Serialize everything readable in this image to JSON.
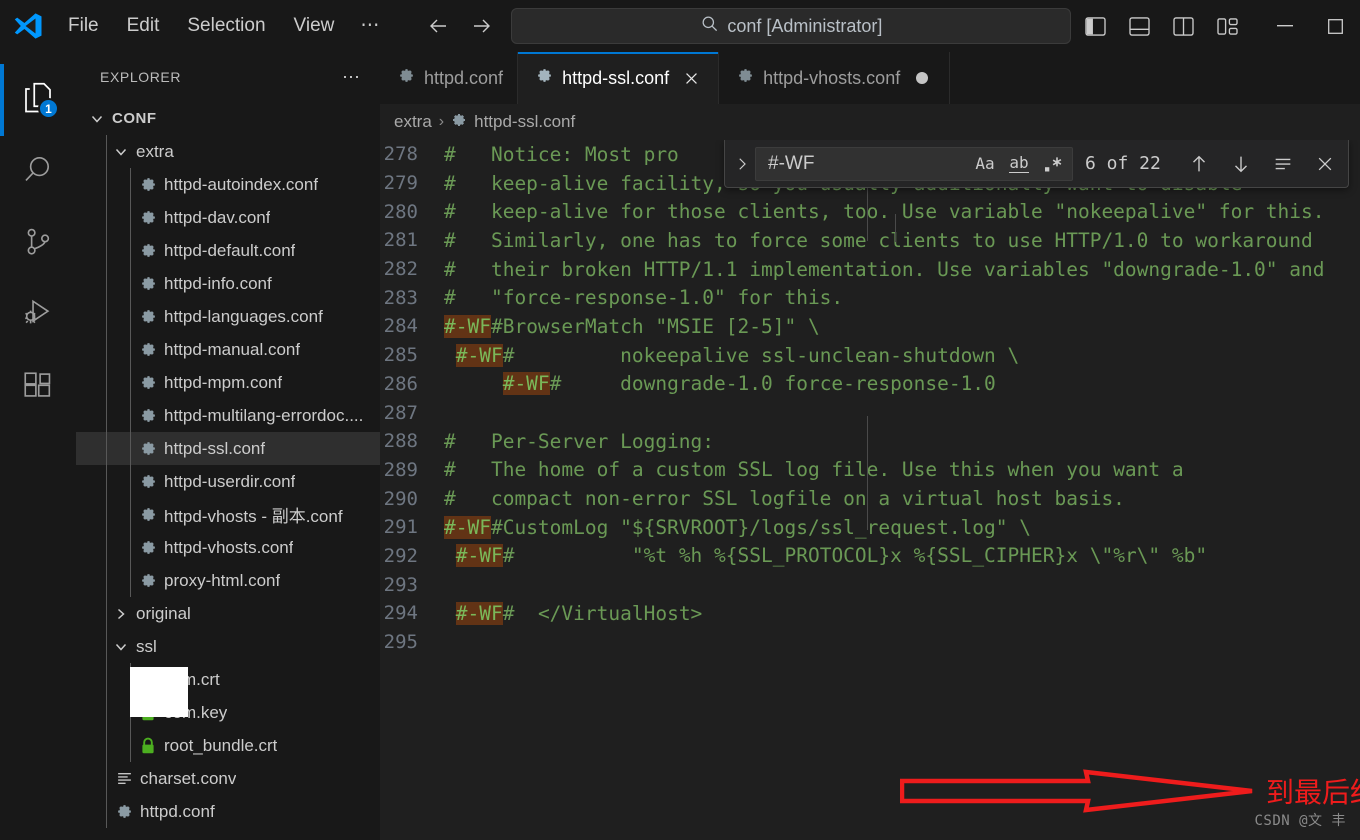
{
  "window": {
    "command_center_text": "conf [Administrator]",
    "search_icon": "search-icon",
    "back_icon": "arrow-left-icon",
    "forward_icon": "arrow-right-icon",
    "minimize_label": "—",
    "maximize_label": "☐",
    "layout_icons": [
      "toggle-primary-sidebar-icon",
      "toggle-panel-icon",
      "toggle-secondary-sidebar-icon",
      "customize-layout-icon"
    ]
  },
  "menubar": {
    "items": [
      {
        "label": "File"
      },
      {
        "label": "Edit"
      },
      {
        "label": "Selection"
      },
      {
        "label": "View"
      },
      {
        "label": "⋯"
      }
    ]
  },
  "activitybar": {
    "items": [
      {
        "name": "explorer",
        "icon": "files-icon",
        "badge": "1",
        "active": true
      },
      {
        "name": "search",
        "icon": "search-icon",
        "badge": "",
        "active": false
      },
      {
        "name": "source-control",
        "icon": "source-control-icon",
        "badge": "",
        "active": false
      },
      {
        "name": "run-debug",
        "icon": "run-and-debug-icon",
        "badge": "",
        "active": false
      },
      {
        "name": "extensions",
        "icon": "extensions-icon",
        "badge": "",
        "active": false
      }
    ]
  },
  "sidebar": {
    "title": "EXPLORER",
    "more_actions": "⋯",
    "tree": [
      {
        "label": "CONF",
        "type": "root-folder",
        "depth": 0,
        "expanded": true,
        "icon": "",
        "selected": false
      },
      {
        "label": "extra",
        "type": "folder",
        "depth": 1,
        "expanded": true,
        "icon": "",
        "selected": false
      },
      {
        "label": "httpd-autoindex.conf",
        "type": "file",
        "depth": 2,
        "icon": "gear-icon",
        "selected": false
      },
      {
        "label": "httpd-dav.conf",
        "type": "file",
        "depth": 2,
        "icon": "gear-icon",
        "selected": false
      },
      {
        "label": "httpd-default.conf",
        "type": "file",
        "depth": 2,
        "icon": "gear-icon",
        "selected": false
      },
      {
        "label": "httpd-info.conf",
        "type": "file",
        "depth": 2,
        "icon": "gear-icon",
        "selected": false
      },
      {
        "label": "httpd-languages.conf",
        "type": "file",
        "depth": 2,
        "icon": "gear-icon",
        "selected": false
      },
      {
        "label": "httpd-manual.conf",
        "type": "file",
        "depth": 2,
        "icon": "gear-icon",
        "selected": false
      },
      {
        "label": "httpd-mpm.conf",
        "type": "file",
        "depth": 2,
        "icon": "gear-icon",
        "selected": false
      },
      {
        "label": "httpd-multilang-errordoc....",
        "type": "file",
        "depth": 2,
        "icon": "gear-icon",
        "selected": false
      },
      {
        "label": "httpd-ssl.conf",
        "type": "file",
        "depth": 2,
        "icon": "gear-icon",
        "selected": true
      },
      {
        "label": "httpd-userdir.conf",
        "type": "file",
        "depth": 2,
        "icon": "gear-icon",
        "selected": false
      },
      {
        "label": "httpd-vhosts - 副本.conf",
        "type": "file",
        "depth": 2,
        "icon": "gear-icon",
        "selected": false
      },
      {
        "label": "httpd-vhosts.conf",
        "type": "file",
        "depth": 2,
        "icon": "gear-icon",
        "selected": false
      },
      {
        "label": "proxy-html.conf",
        "type": "file",
        "depth": 2,
        "icon": "gear-icon",
        "selected": false
      },
      {
        "label": "original",
        "type": "folder",
        "depth": 1,
        "expanded": false,
        "icon": "",
        "selected": false
      },
      {
        "label": "ssl",
        "type": "folder",
        "depth": 1,
        "expanded": true,
        "icon": "",
        "selected": false
      },
      {
        "label": "com.crt",
        "type": "file",
        "depth": 2,
        "icon": "lock-icon",
        "selected": false,
        "redacted": true
      },
      {
        "label": "com.key",
        "type": "file",
        "depth": 2,
        "icon": "lock-icon",
        "selected": false,
        "redacted": true
      },
      {
        "label": "root_bundle.crt",
        "type": "file",
        "depth": 2,
        "icon": "lock-icon",
        "selected": false
      },
      {
        "label": "charset.conv",
        "type": "file",
        "depth": 1,
        "icon": "lines-icon",
        "selected": false
      },
      {
        "label": "httpd.conf",
        "type": "file",
        "depth": 1,
        "icon": "gear-icon",
        "selected": false
      }
    ]
  },
  "tabs": [
    {
      "label": "httpd.conf",
      "icon": "gear-icon",
      "active": false,
      "dirty": false,
      "closable": false
    },
    {
      "label": "httpd-ssl.conf",
      "icon": "gear-icon",
      "active": true,
      "dirty": false,
      "closable": true,
      "close_icon": "close-icon"
    },
    {
      "label": "httpd-vhosts.conf",
      "icon": "gear-icon",
      "active": false,
      "dirty": true,
      "closable": false
    }
  ],
  "breadcrumb": {
    "segments": [
      "extra",
      "httpd-ssl.conf"
    ],
    "separator": "›",
    "file_icon": "gear-icon"
  },
  "find_widget": {
    "toggle_replace_icon": "chevron-right-icon",
    "query": "#-WF",
    "placeholder": "Find",
    "match_case_label": "Aa",
    "whole_word_label": "ab",
    "regex_label": ".*",
    "match_count": "6 of 22",
    "previous_icon": "arrow-up-icon",
    "next_icon": "arrow-down-icon",
    "find_in_selection_icon": "selection-icon",
    "close_icon": "close-icon"
  },
  "editor": {
    "first_line_number": 278,
    "lines": [
      {
        "n": 278,
        "segments": [
          {
            "t": "#   Notice: Most pro",
            "hl": false
          }
        ]
      },
      {
        "n": 279,
        "segments": [
          {
            "t": "#   keep-alive facility, so you usually additionally want to disable",
            "hl": false
          }
        ]
      },
      {
        "n": 280,
        "segments": [
          {
            "t": "#   keep-alive for those clients, too. Use variable \"nokeepalive\" for this.",
            "hl": false
          }
        ]
      },
      {
        "n": 281,
        "segments": [
          {
            "t": "#   Similarly, one has to force some clients to use HTTP/1.0 to workaround",
            "hl": false
          }
        ]
      },
      {
        "n": 282,
        "segments": [
          {
            "t": "#   their broken HTTP/1.1 implementation. Use variables \"downgrade-1.0\" and",
            "hl": false
          }
        ]
      },
      {
        "n": 283,
        "segments": [
          {
            "t": "#   \"force-response-1.0\" for this.",
            "hl": false
          }
        ]
      },
      {
        "n": 284,
        "segments": [
          {
            "t": "#-WF",
            "hl": true
          },
          {
            "t": "#BrowserMatch \"MSIE [2-5]\" \\",
            "hl": false
          }
        ]
      },
      {
        "n": 285,
        "segments": [
          {
            "t": " ",
            "hl": false
          },
          {
            "t": "#-WF",
            "hl": true
          },
          {
            "t": "#         nokeepalive ssl-unclean-shutdown \\",
            "hl": false
          }
        ]
      },
      {
        "n": 286,
        "segments": [
          {
            "t": "     ",
            "hl": false
          },
          {
            "t": "#-WF",
            "hl": true
          },
          {
            "t": "#     downgrade-1.0 force-response-1.0",
            "hl": false
          }
        ]
      },
      {
        "n": 287,
        "segments": []
      },
      {
        "n": 288,
        "segments": [
          {
            "t": "#   Per-Server Logging:",
            "hl": false
          }
        ]
      },
      {
        "n": 289,
        "segments": [
          {
            "t": "#   The home of a custom SSL log file. Use this when you want a",
            "hl": false
          }
        ]
      },
      {
        "n": 290,
        "segments": [
          {
            "t": "#   compact non-error SSL logfile on a virtual host basis.",
            "hl": false
          }
        ]
      },
      {
        "n": 291,
        "segments": [
          {
            "t": "#-WF",
            "hl": true
          },
          {
            "t": "#CustomLog \"${SRVROOT}/logs/ssl_request.log\" \\",
            "hl": false
          }
        ]
      },
      {
        "n": 292,
        "segments": [
          {
            "t": " ",
            "hl": false
          },
          {
            "t": "#-WF",
            "hl": true
          },
          {
            "t": "#          \"%t %h %{SSL_PROTOCOL}x %{SSL_CIPHER}x \\\"%r\\\" %b\"",
            "hl": false
          }
        ]
      },
      {
        "n": 293,
        "segments": []
      },
      {
        "n": 294,
        "segments": [
          {
            "t": " ",
            "hl": false
          },
          {
            "t": "#-WF",
            "hl": true
          },
          {
            "t": "#  </VirtualHost>",
            "hl": false
          }
        ]
      },
      {
        "n": 295,
        "segments": []
      }
    ]
  },
  "annotation": {
    "text": "到最后结束位置全部注释掉",
    "color": "#ee1c1c",
    "shape": "right-arrow"
  },
  "watermark": {
    "text": "CSDN @文 丰"
  },
  "colors": {
    "accent": "#0078d4",
    "titlebar_bg": "#181818",
    "editor_bg": "#1f1f1f",
    "comment_green": "#6a9955",
    "find_match_bg": "#623315",
    "annotation_red": "#ee1c1c",
    "lock_green": "#4caf20"
  }
}
